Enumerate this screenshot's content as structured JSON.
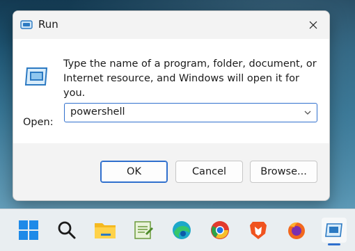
{
  "dialog": {
    "title": "Run",
    "close_icon": "close-icon",
    "description": "Type the name of a program, folder, document, or Internet resource, and Windows will open it for you.",
    "open_label": "Open:",
    "open_value": "powershell",
    "buttons": {
      "ok": "OK",
      "cancel": "Cancel",
      "browse": "Browse..."
    }
  },
  "taskbar": {
    "items": [
      {
        "name": "start-icon"
      },
      {
        "name": "search-icon"
      },
      {
        "name": "file-explorer-icon"
      },
      {
        "name": "notepad-icon"
      },
      {
        "name": "edge-icon"
      },
      {
        "name": "chrome-icon"
      },
      {
        "name": "brave-icon"
      },
      {
        "name": "firefox-icon"
      },
      {
        "name": "run-app-icon",
        "active": true
      }
    ]
  },
  "colors": {
    "accent": "#2f6fcd",
    "dialog_bg": "#f3f3f3",
    "taskbar_bg": "#e9eef1"
  }
}
